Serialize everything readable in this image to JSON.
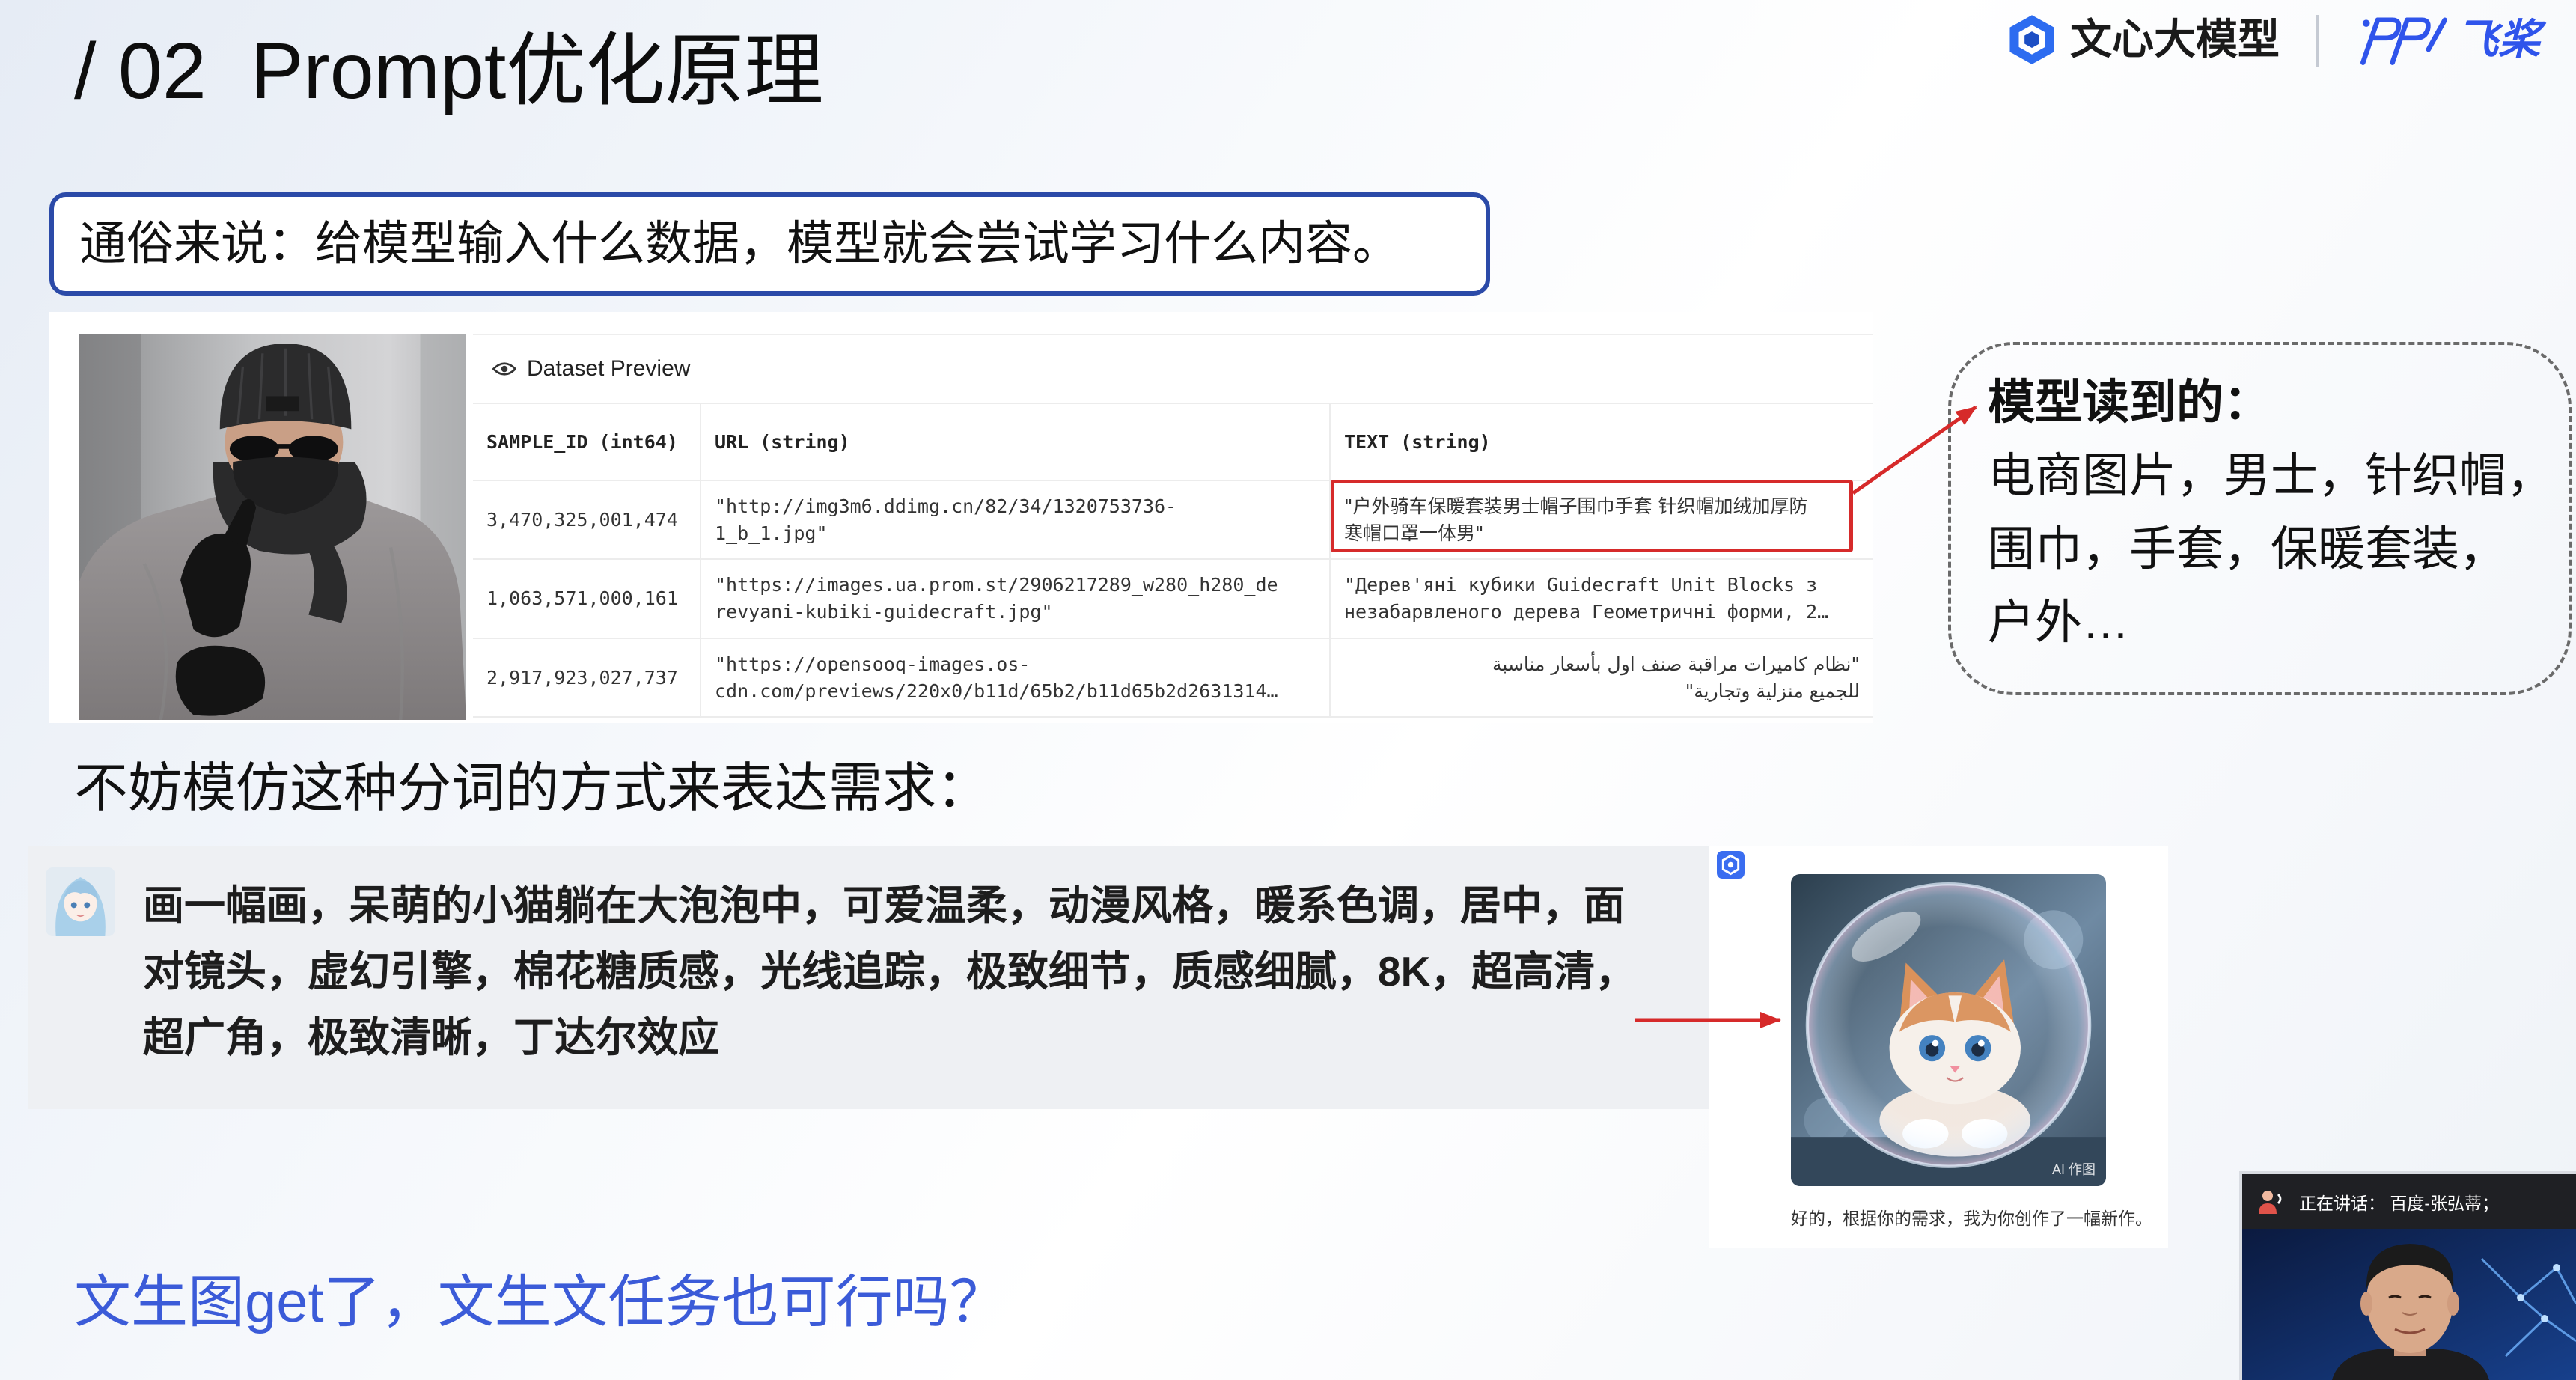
{
  "slide": {
    "title": "/ 02  Prompt优化原理",
    "brand": {
      "wenxin_label": "文心大模型",
      "paddle_label": "飞桨"
    },
    "summary": "通俗来说：给模型输入什么数据，模型就会尝试学习什么内容。",
    "dataset_preview": {
      "title": "Dataset Preview",
      "columns": [
        "SAMPLE_ID (int64)",
        "URL (string)",
        "TEXT (string)"
      ],
      "rows": [
        {
          "sample_id": "3,470,325,001,474",
          "url": [
            "\"http://img3m6.ddimg.cn/82/34/1320753736-",
            "1_b_1.jpg\""
          ],
          "text": [
            "\"户外骑车保暖套装男士帽子围巾手套 针织帽加绒加厚防",
            "寒帽口罩一体男\""
          ]
        },
        {
          "sample_id": "1,063,571,000,161",
          "url": [
            "\"https://images.ua.prom.st/2906217289_w280_h280_de",
            "revyani-kubiki-guidecraft.jpg\""
          ],
          "text": [
            "\"Дерев'яні кубики Guidecraft Unit Blocks з",
            "незабарвленого дерева Геометричні форми, 2…"
          ]
        },
        {
          "sample_id": "2,917,923,027,737",
          "url": [
            "\"https://opensooq-images.os-",
            "cdn.com/previews/220x0/b11d/65b2/b11d65b2d2631314…"
          ],
          "text": [
            "\"نظام كاميرات مراقبة صنف اول بأسعار مناسبة",
            "للجميع منزلية وتجارية\""
          ]
        }
      ]
    },
    "model_reads": {
      "heading": "模型读到的：",
      "lines": [
        "电商图片，男士，针织帽，",
        "围巾，手套，保暖套装，",
        "户外…"
      ]
    },
    "imitate_hint": "不妨模仿这种分词的方式来表达需求：",
    "chat": {
      "prompt_lines": [
        "画一幅画，呆萌的小猫躺在大泡泡中，可爱温柔，动漫风格，暖系色调，居中，面",
        "对镜头，虚幻引擎，棉花糖质感，光线追踪，极致细节，质感细腻，8K，超高清，",
        "超广角，极致清晰，丁达尔效应"
      ],
      "image_badge": "AI 作图",
      "reply": "好的，根据你的需求，我为你创作了一幅新作。"
    },
    "question": "文生图get了，文生文任务也可行吗？",
    "video": {
      "speaking": "正在讲话： 百度-张弘蒂；"
    }
  },
  "colors": {
    "summary-border": "#2b4aa8",
    "question-text": "#3b5bd8",
    "highlight-red": "#d62a2a",
    "brand-blue": "#2f54eb"
  },
  "icons": {
    "brand": "wenxin-logo-icon",
    "paddle": "paddle-logo-icon",
    "preview": "eye-icon",
    "chat_app": "chat-app-icon",
    "speaker": "speaker-icon"
  }
}
